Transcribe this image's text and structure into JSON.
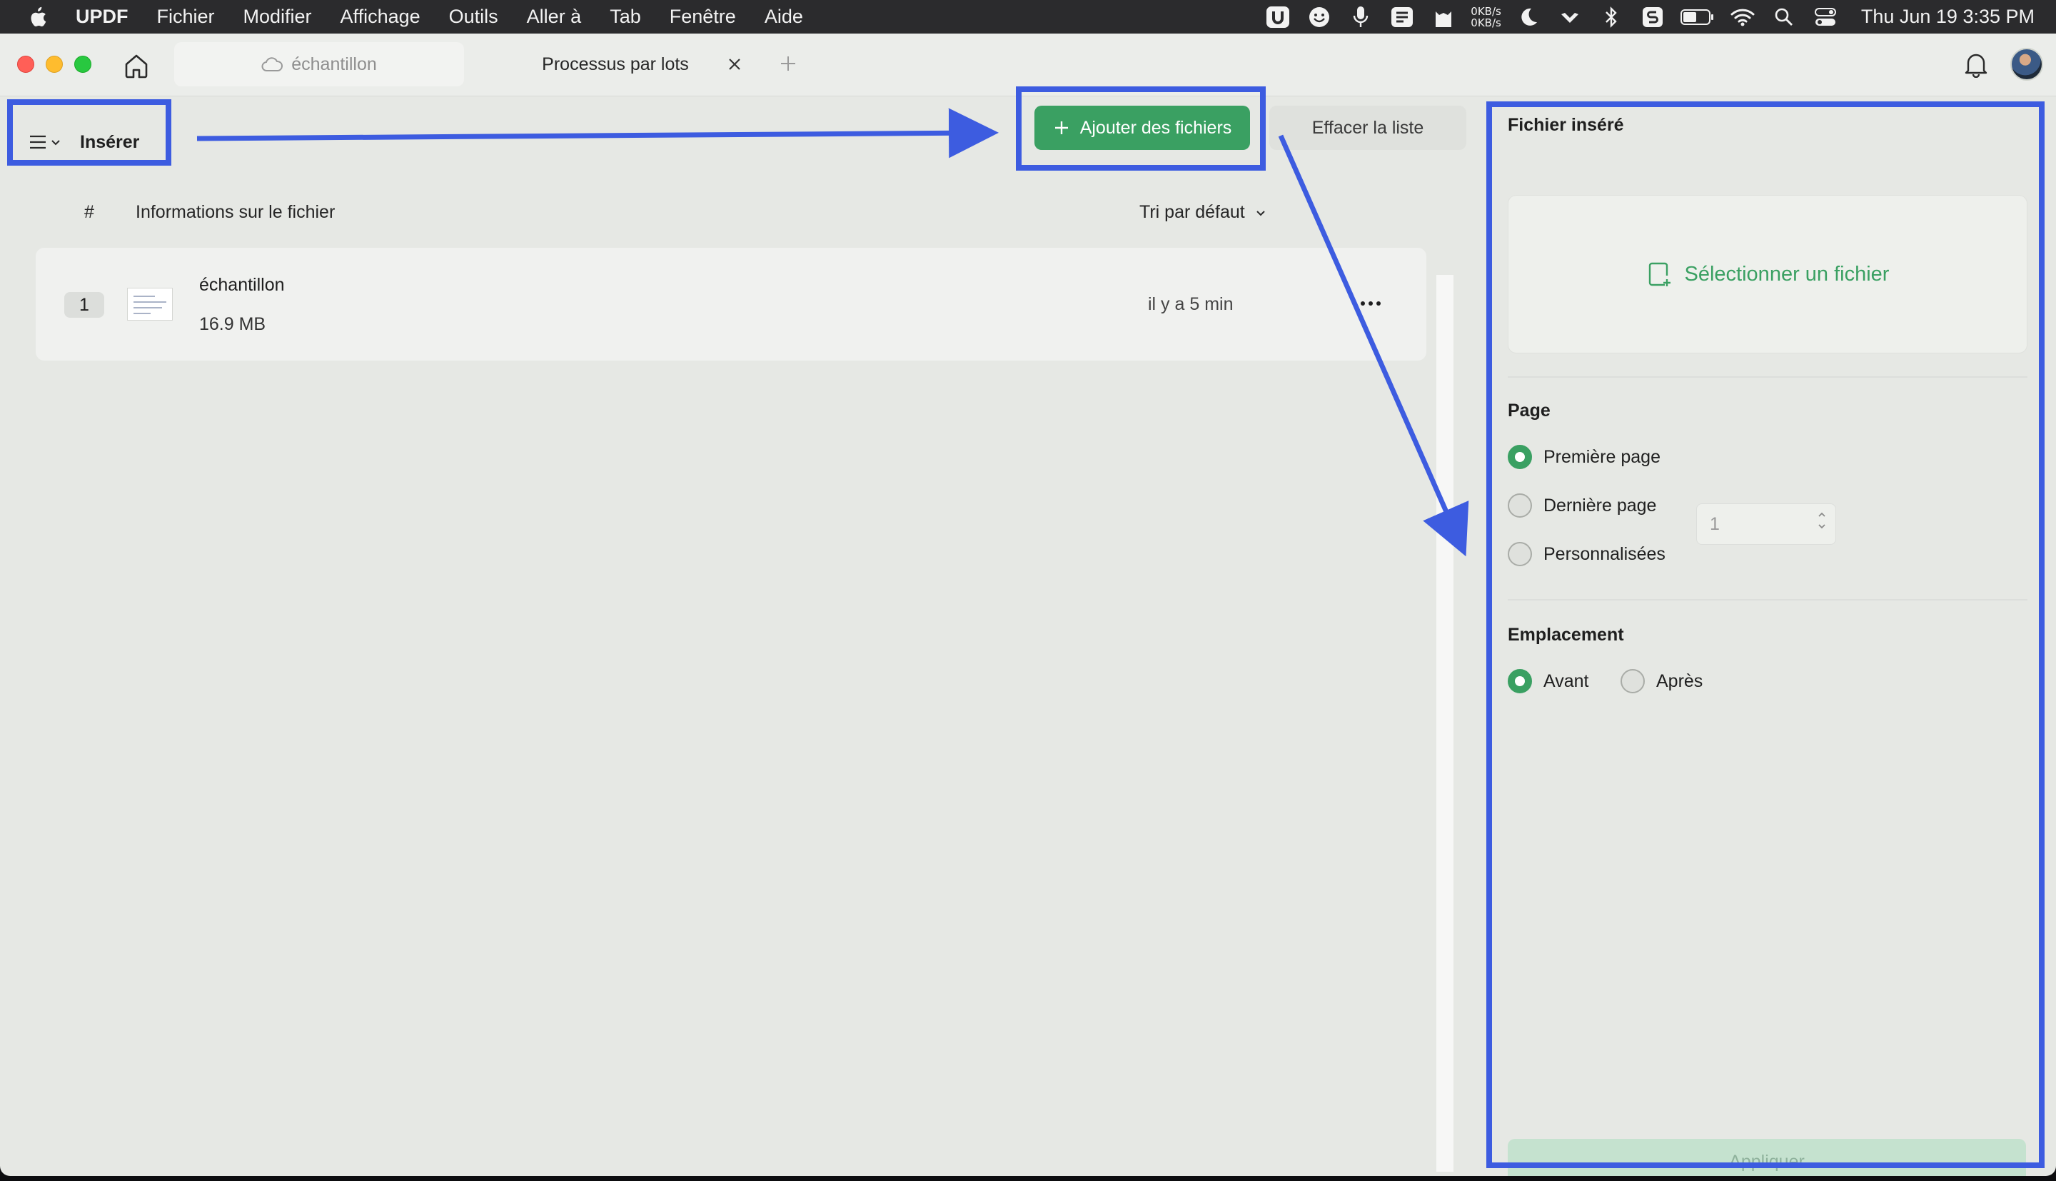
{
  "menubar": {
    "app_name": "UPDF",
    "menus": [
      "Fichier",
      "Modifier",
      "Affichage",
      "Outils",
      "Aller à",
      "Tab",
      "Fenêtre",
      "Aide"
    ],
    "net_up": "0KB/s",
    "net_down": "0KB/s",
    "clock": "Thu Jun 19  3:35 PM"
  },
  "tabs": {
    "document": "échantillon",
    "active": "Processus par lots"
  },
  "toolbar": {
    "tool_label": "Insérer",
    "add_files": "Ajouter des fichiers",
    "clear_list": "Effacer la liste"
  },
  "list": {
    "col_hash": "#",
    "col_info": "Informations sur le fichier",
    "sort_label": "Tri par défaut",
    "files": [
      {
        "index": "1",
        "name": "échantillon",
        "size": "16.9 MB",
        "modified": "il y a 5 min"
      }
    ]
  },
  "panel": {
    "inserted_title": "Fichier inséré",
    "select_file": "Sélectionner un fichier",
    "page_title": "Page",
    "page_options": [
      "Première page",
      "Dernière page",
      "Personnalisées"
    ],
    "page_selected": "Première page",
    "custom_value": "1",
    "location_title": "Emplacement",
    "location_options": [
      "Avant",
      "Après"
    ],
    "location_selected": "Avant",
    "apply": "Appliquer"
  },
  "colors": {
    "accent_green": "#3aa062",
    "annotation_blue": "#3d5ce0"
  }
}
